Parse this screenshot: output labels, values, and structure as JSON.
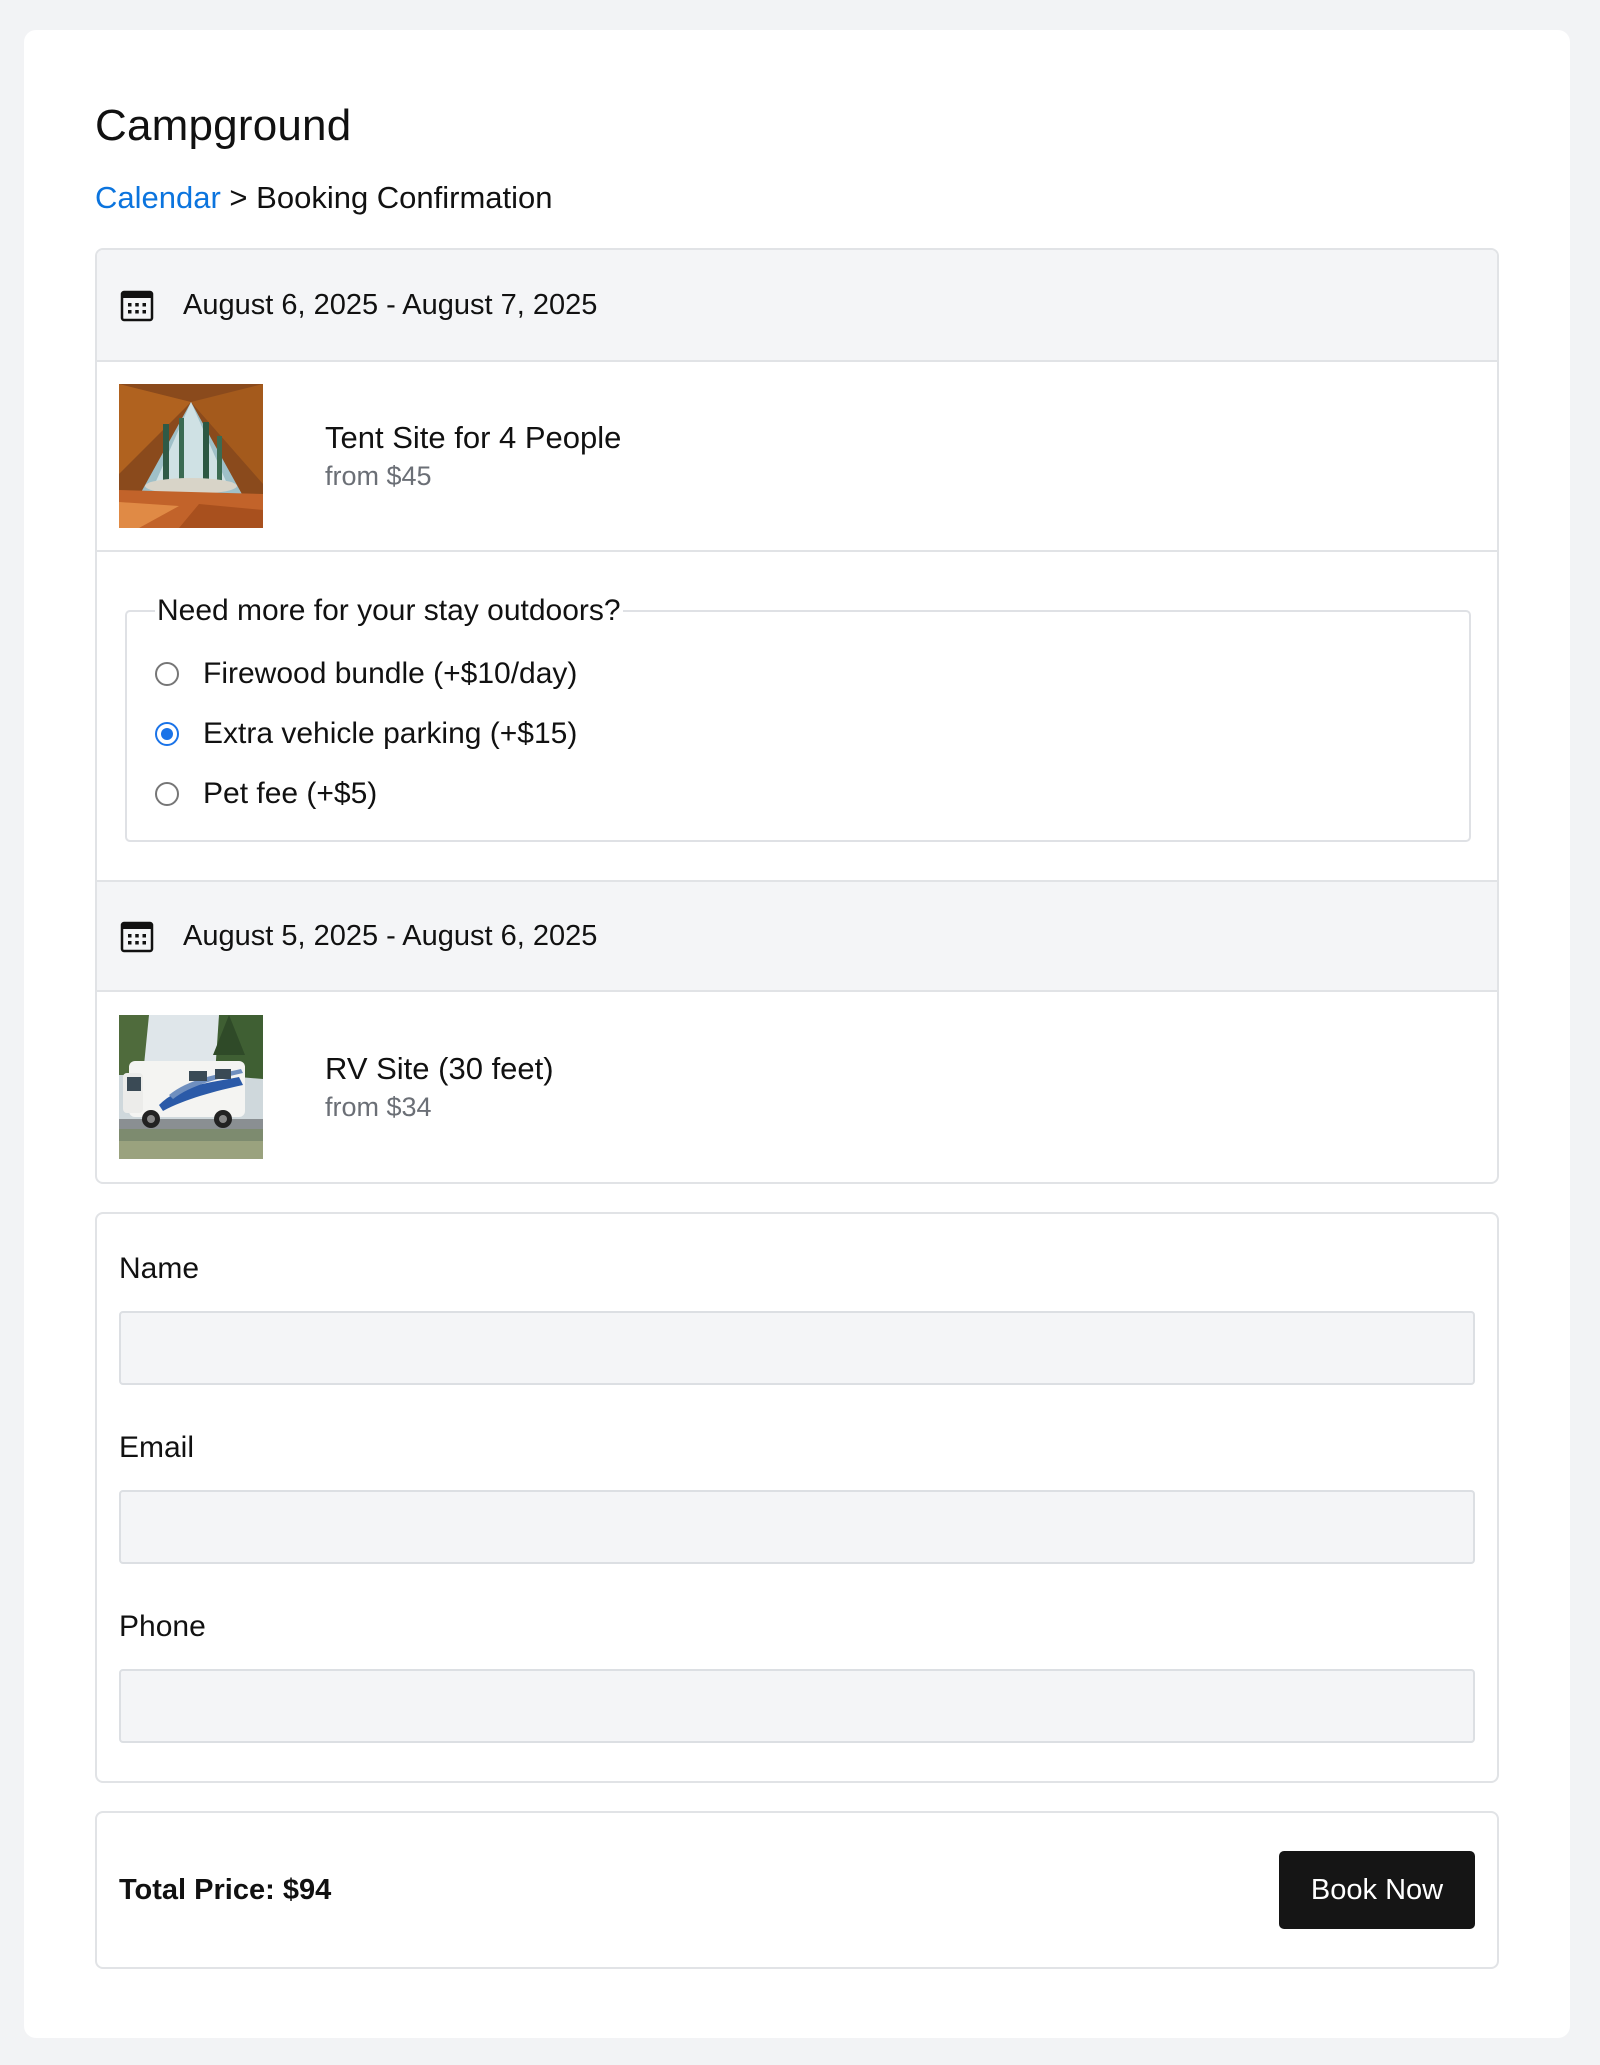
{
  "page": {
    "title": "Campground"
  },
  "breadcrumb": {
    "link": "Calendar",
    "separator": " > ",
    "current": "Booking Confirmation"
  },
  "bookings": [
    {
      "date_range": "August 6, 2025 - August 7, 2025",
      "site_name": "Tent Site for 4 People",
      "site_price": "from $45",
      "image": "tent-interior-photo",
      "extras": {
        "legend": "Need more for your stay outdoors?",
        "options": [
          {
            "label": "Firewood bundle (+$10/day)",
            "checked": false
          },
          {
            "label": "Extra vehicle parking (+$15)",
            "checked": true
          },
          {
            "label": "Pet fee (+$5)",
            "checked": false
          }
        ]
      }
    },
    {
      "date_range": "August 5, 2025 - August 6, 2025",
      "site_name": "RV Site (30 feet)",
      "site_price": "from $34",
      "image": "rv-motorhome-photo"
    }
  ],
  "form": {
    "name_label": "Name",
    "email_label": "Email",
    "phone_label": "Phone",
    "name_value": "",
    "email_value": "",
    "phone_value": ""
  },
  "summary": {
    "total_price": "Total Price: $94",
    "book_label": "Book Now"
  },
  "colors": {
    "link": "#0b74de",
    "radio_checked": "#1a73e8",
    "button_bg": "#151515"
  },
  "icons": {
    "date": "calendar-icon"
  }
}
